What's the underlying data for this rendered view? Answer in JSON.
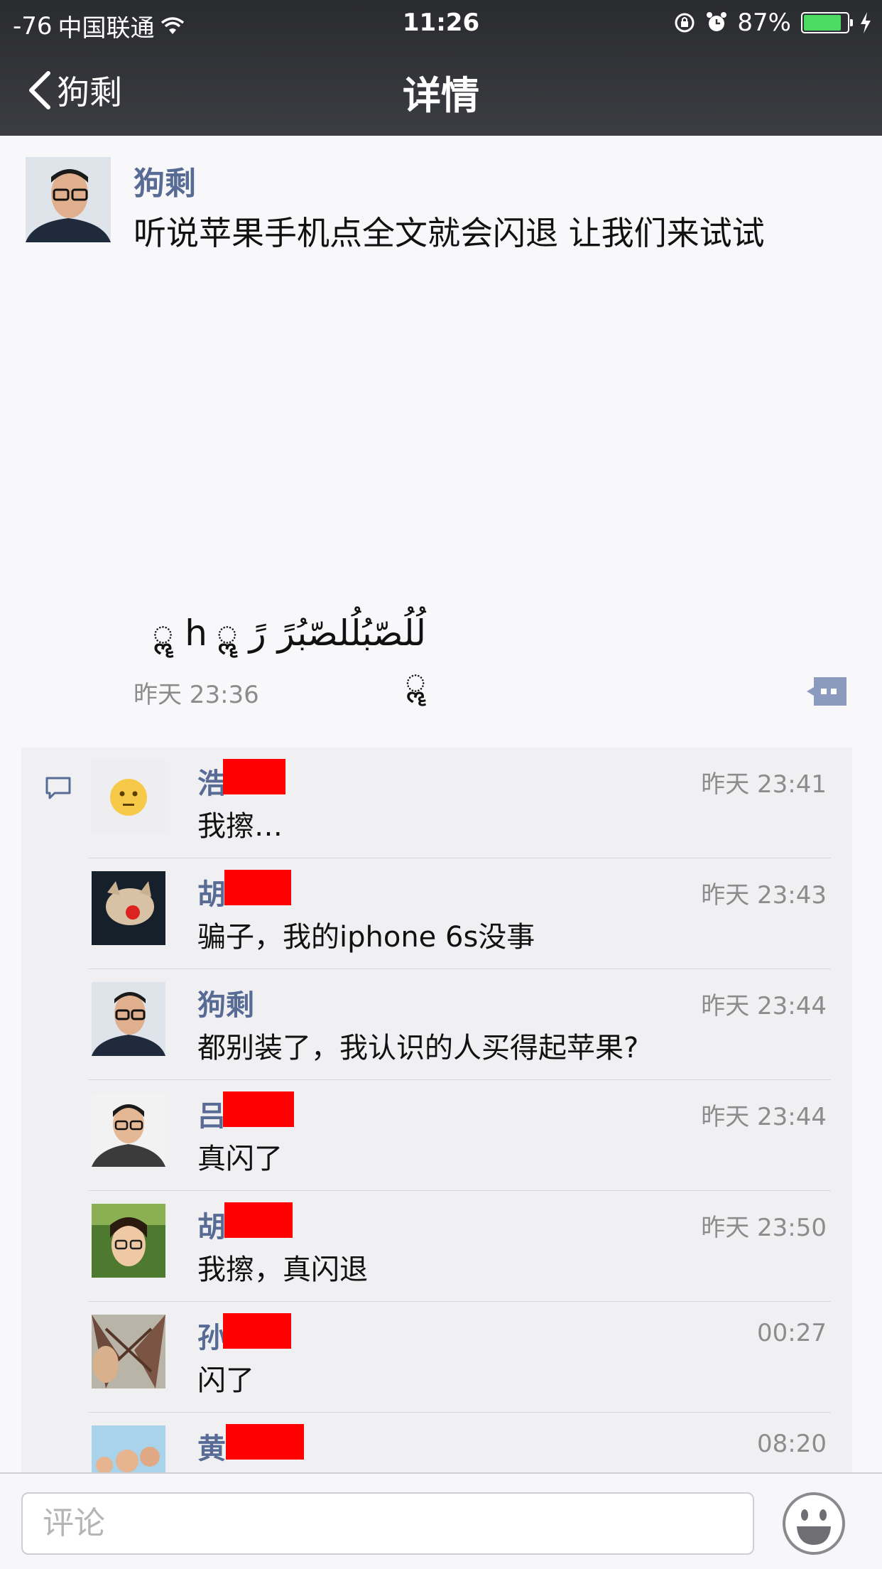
{
  "status_bar": {
    "signal": "-76",
    "carrier": "中国联通",
    "time": "11:26",
    "battery_percent": "87%",
    "battery_level": 0.87
  },
  "nav": {
    "back_label": "狗剩",
    "title": "详情"
  },
  "post": {
    "author": "狗剩",
    "text": "听说苹果手机点全文就会闪退 让我们来试试",
    "arabic_text": "لُلُصّبُلُلصّبُرً رً ॣ ॣh ॣ ॣ ॣ",
    "time": "昨天 23:36"
  },
  "comments": [
    {
      "name": "浩",
      "time": "昨天 23:41",
      "text": "我擦…"
    },
    {
      "name": "胡",
      "time": "昨天 23:43",
      "text": "骗子，我的iphone 6s没事"
    },
    {
      "name": "狗剩",
      "time": "昨天 23:44",
      "text": "都别装了，我认识的人买得起苹果?"
    },
    {
      "name": "吕",
      "time": "昨天 23:44",
      "text": "真闪了"
    },
    {
      "name": "胡",
      "time": "昨天 23:50",
      "text": "我擦，真闪退"
    },
    {
      "name": "孙",
      "time": "00:27",
      "text": "闪了"
    },
    {
      "name": "黄",
      "time": "08:20",
      "text": ""
    }
  ],
  "input": {
    "placeholder": "评论"
  },
  "colors": {
    "name_blue": "#576b95",
    "redaction": "#ff0000",
    "battery_green": "#4cd964"
  }
}
